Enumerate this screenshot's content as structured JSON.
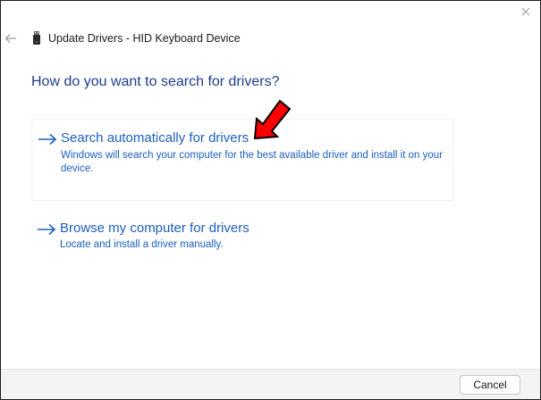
{
  "window": {
    "title": "Update Drivers - HID Keyboard Device"
  },
  "main": {
    "question": "How do you want to search for drivers?",
    "options": [
      {
        "title": "Search automatically for drivers",
        "description": "Windows will search your computer for the best available driver and install it on your device."
      },
      {
        "title": "Browse my computer for drivers",
        "description": "Locate and install a driver manually."
      }
    ]
  },
  "footer": {
    "cancel_label": "Cancel"
  },
  "colors": {
    "link_blue": "#1c5fbf",
    "heading_blue": "#1f3d8a",
    "annotation_red": "#ff0000"
  },
  "icons": {
    "close": "close-icon",
    "back": "back-arrow-icon",
    "device": "usb-device-icon",
    "option_arrow": "arrow-right-icon",
    "annotation": "red-pointer-arrow-icon"
  }
}
